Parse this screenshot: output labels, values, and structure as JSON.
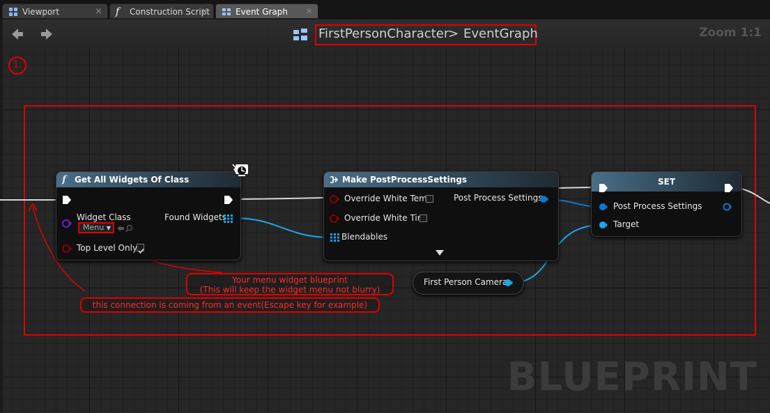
{
  "tabs": [
    {
      "label": "Viewport",
      "icon": "viewport-icon"
    },
    {
      "label": "Construction Script",
      "icon": "function-icon"
    },
    {
      "label": "Event Graph",
      "icon": "graph-icon",
      "active": true
    }
  ],
  "toolbar": {
    "breadcrumb_root": "FirstPersonCharacter",
    "breadcrumb_separator": ">",
    "breadcrumb_leaf": "EventGraph",
    "zoom": "Zoom 1:1"
  },
  "annotations": {
    "step_number": "1.",
    "callout_widget_line1": "Your menu widget blueprint",
    "callout_widget_line2": "(This will keep the widget menu not blurry)",
    "callout_event": "this connection is coming from an event(Escape key for example)"
  },
  "nodes": {
    "get_all_widgets": {
      "title": "Get All Widgets Of Class",
      "widget_class_label": "Widget Class",
      "widget_class_value": "Menu",
      "found_widgets_label": "Found Widgets",
      "top_level_only_label": "Top Level Only",
      "top_level_only_checked": true
    },
    "make_pps": {
      "title": "Make PostProcessSettings",
      "override_white_temp": "Override White Temp",
      "override_white_tint": "Override White Tint",
      "blendables": "Blendables",
      "output_label": "Post Process Settings"
    },
    "set": {
      "title": "SET",
      "post_process_settings": "Post Process Settings",
      "target": "Target"
    },
    "camera_var": {
      "label": "First Person Camera"
    }
  },
  "watermark": "BLUEPRINT",
  "colors": {
    "annotation_red": "#e00000",
    "struct_pin": "#0b78d4",
    "object_pin": "#1aa7ec",
    "class_pin": "#6a1fd6",
    "bool_pin": "#8a0000",
    "exec_wire": "#ffffff"
  }
}
